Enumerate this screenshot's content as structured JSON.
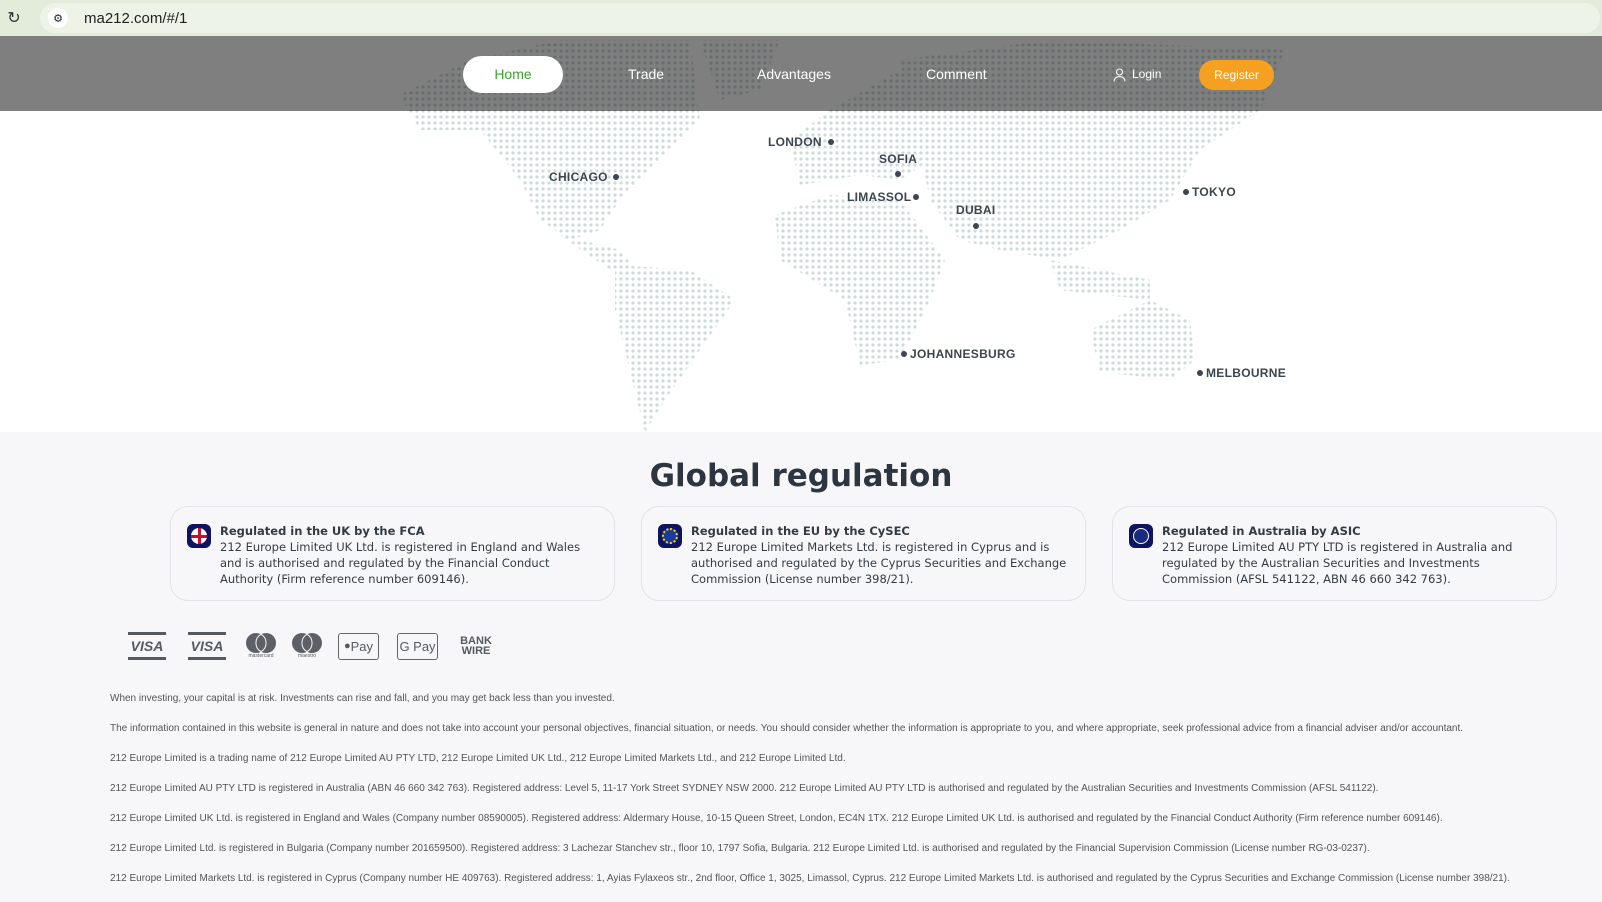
{
  "browser": {
    "url": "ma212.com/#/1"
  },
  "nav": {
    "home": "Home",
    "trade": "Trade",
    "advantages": "Advantages",
    "comment": "Comment",
    "login": "Login",
    "register": "Register"
  },
  "map": {
    "cities": [
      "LONDON",
      "SOFIA",
      "CHICAGO",
      "LIMASSOL",
      "DUBAI",
      "TOKYO",
      "JOHANNESBURG",
      "MELBOURNE"
    ]
  },
  "regulation": {
    "title": "Global regulation",
    "cards": [
      {
        "title": "Regulated in the UK by the FCA",
        "text": "212 Europe Limited UK Ltd. is registered in England and Wales and is authorised and regulated by the Financial Conduct Authority (Firm reference number 609146).",
        "icon": "uk-flag-icon"
      },
      {
        "title": "Regulated in the EU by the CySEC",
        "text": "212 Europe Limited Markets Ltd. is registered in Cyprus and is authorised and regulated by the Cyprus Securities and Exchange Commission (License number 398/21).",
        "icon": "eu-flag-icon"
      },
      {
        "title": "Regulated in Australia by ASIC",
        "text": "212 Europe Limited AU PTY LTD is registered in Australia and regulated by the Australian Securities and Investments Commission (AFSL 541122, ABN 46 660 342 763).",
        "icon": "au-flag-icon"
      }
    ]
  },
  "payments": {
    "visa": "VISA",
    "visa_electron": "VISA",
    "mastercard": "mastercard",
    "maestro": "maestro",
    "apple_pay": "Pay",
    "google_pay": "G Pay",
    "bank_wire": "BANK WIRE"
  },
  "disclaimers": [
    "When investing, your capital is at risk. Investments can rise and fall, and you may get back less than you invested.",
    "The information contained in this website is general in nature and does not take into account your personal objectives, financial situation, or needs. You should consider whether the information is appropriate to you, and where appropriate, seek professional advice from a financial adviser and/or accountant.",
    "212 Europe Limited is a trading name of 212 Europe Limited AU PTY LTD, 212 Europe Limited UK Ltd., 212 Europe Limited Markets Ltd., and 212 Europe Limited Ltd.",
    "212 Europe Limited AU PTY LTD is registered in Australia (ABN 46 660 342 763). Registered address: Level 5, 11-17 York Street SYDNEY NSW 2000. 212 Europe Limited AU PTY LTD is authorised and regulated by the Australian Securities and Investments Commission (AFSL 541122).",
    "212 Europe Limited UK Ltd. is registered in England and Wales (Company number 08590005). Registered address: Aldermary House, 10-15 Queen Street, London, EC4N 1TX. 212 Europe Limited UK Ltd. is authorised and regulated by the Financial Conduct Authority (Firm reference number 609146).",
    "212 Europe Limited Ltd. is registered in Bulgaria (Company number 201659500). Registered address: 3 Lachezar Stanchev str., floor 10, 1797 Sofia, Bulgaria. 212 Europe Limited Ltd. is authorised and regulated by the Financial Supervision Commission (License number RG-03-0237).",
    "212 Europe Limited Markets Ltd. is registered in Cyprus (Company number HE 409763). Registered address: 1, Ayias Fylaxeos str., 2nd floor, Office 1, 3025, Limassol, Cyprus. 212 Europe Limited Markets Ltd. is authorised and regulated by the Cyprus Securities and Exchange Commission (License number 398/21)."
  ],
  "colors": {
    "accent": "#3aa52a",
    "register": "#f5a020",
    "map_dots": "#cddcdb"
  }
}
